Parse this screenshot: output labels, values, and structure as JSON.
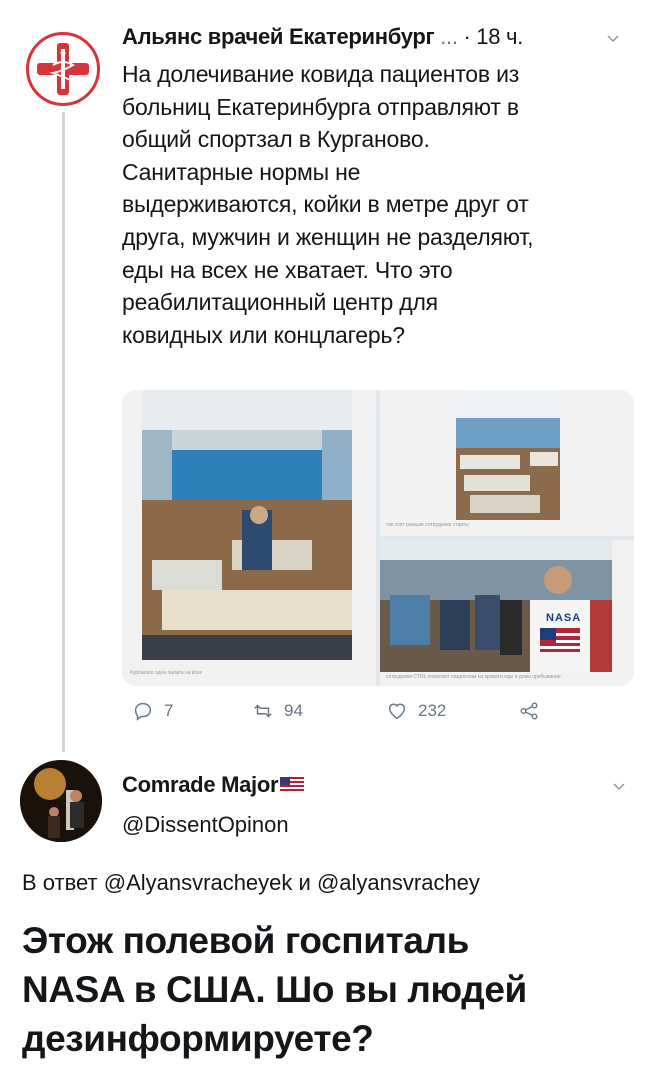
{
  "tweet": {
    "author_name": "Альянс врачей Екатеринбург",
    "ellipsis": "...",
    "time_sep": "·",
    "time": "18 ч.",
    "text": "На долечивание ковида пациентов из\nбольниц Екатеринбурга отправляют в\nобщий спортзал в Курганово.\nСанитарные нормы не\nвыдерживаются, койки в метре друг от\nдруга, мужчин и женщин не разделяют,\nеды на всех не хватает. Что это\nреабилитационный центр для\nковидных или концлагерь?",
    "media": {
      "photo1_caption": "Курганово одна палата на всех",
      "photo2_caption": "так спят раньше сотрудники старты",
      "photo3_caption": "сотрудники CTRL помогают пациентам на кровати еды и дома пребывание",
      "shirt_text": "NASA"
    },
    "actions": {
      "replies": "7",
      "retweets": "94",
      "likes": "232"
    }
  },
  "reply": {
    "author_name": "Comrade Major",
    "handle": "@DissentOpinon",
    "reply_prefix": "В ответ",
    "mention1": "@Alyansvracheyek",
    "conj": "и",
    "mention2": "@alyansvrachey",
    "text": "Этож полевой госпиталь\nNASA в США. Шо вы людей\nдезинформируете?"
  },
  "colors": {
    "logo_red": "#d6333b",
    "text": "#14171a",
    "muted": "#657786",
    "thread": "#ccd6dd"
  },
  "icons": [
    "medical-cross-logo-icon",
    "chevron-down-icon",
    "reply-icon",
    "retweet-icon",
    "like-icon",
    "share-icon",
    "us-flag-icon"
  ]
}
